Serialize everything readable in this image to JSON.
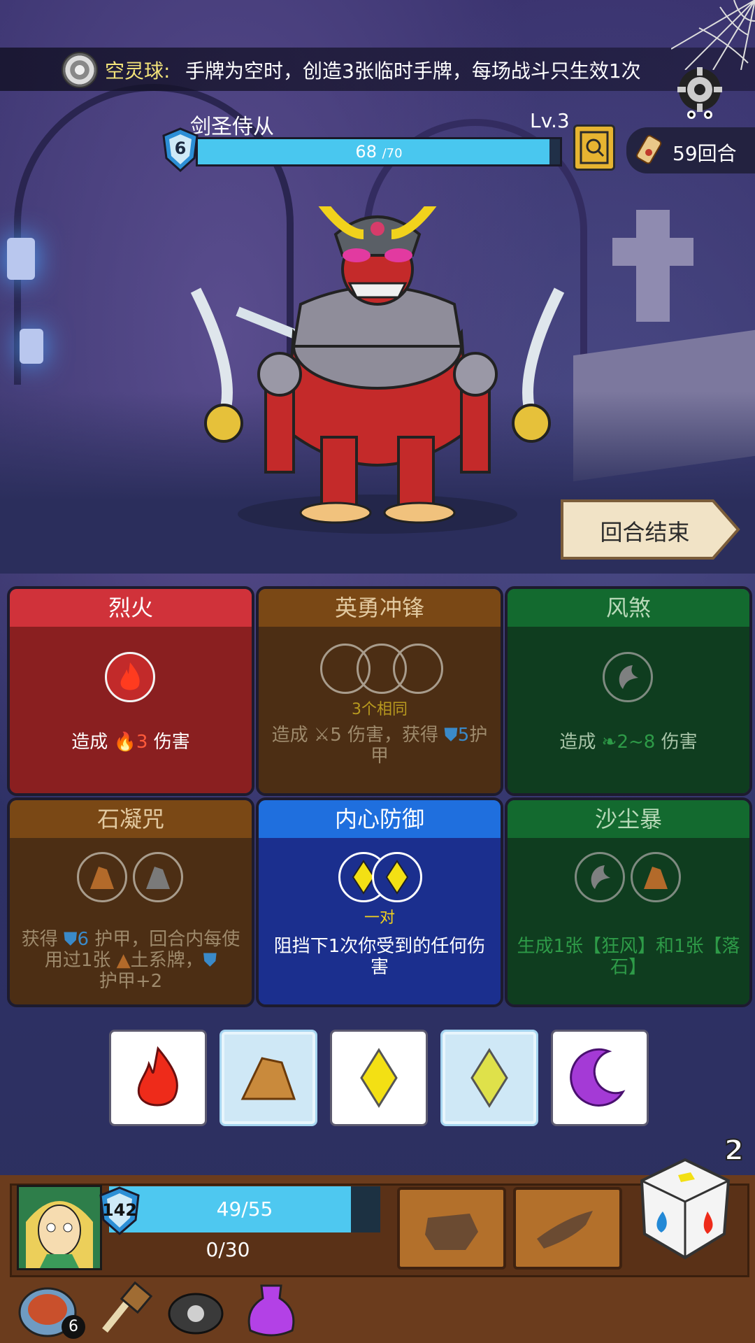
{
  "effect_banner": {
    "title": "空灵球:",
    "text": "手牌为空时，创造3张临时手牌，每场战斗只生效1次"
  },
  "enemy": {
    "name": "剑圣侍从",
    "level": "Lv.3",
    "shield": "6",
    "hp_current": "68",
    "hp_max": "/70",
    "hp_fraction": 0.971
  },
  "turns": {
    "label": "59回合"
  },
  "end_turn": {
    "label": "回合结束"
  },
  "cards": [
    {
      "title": "烈火",
      "desc_pre": "造成 ",
      "desc_val": "3",
      "desc_post": " 伤害",
      "color": "red"
    },
    {
      "title": "英勇冲锋",
      "sub": "3个相同",
      "desc_pre": "造成 ",
      "desc_val": "5",
      "desc_mid": " 伤害，获得 ",
      "desc_val2": "5",
      "desc_post": "护甲",
      "color": "brown"
    },
    {
      "title": "风煞",
      "desc_pre": "造成 ",
      "desc_val": "2~8",
      "desc_post": " 伤害",
      "color": "green"
    },
    {
      "title": "石凝咒",
      "desc_pre": "获得 ",
      "desc_val": "6",
      "desc_mid": " 护甲，回合内每使用过1张 ",
      "desc_mid2": "土系牌，",
      "desc_post": "护甲+2",
      "color": "brown"
    },
    {
      "title": "内心防御",
      "sub": "一对",
      "desc": "阻挡下1次你受到的任何伤害",
      "color": "blue"
    },
    {
      "title": "沙尘暴",
      "desc": "生成1张【狂风】和1张【落石】",
      "color": "green"
    }
  ],
  "hand_dice": [
    {
      "icon": "fire-icon",
      "frozen": false
    },
    {
      "icon": "rock-icon",
      "frozen": true
    },
    {
      "icon": "diamond-icon",
      "frozen": false
    },
    {
      "icon": "diamond-icon",
      "frozen": true
    },
    {
      "icon": "moon-icon",
      "frozen": false
    }
  ],
  "player": {
    "shield": "142",
    "hp": "49/55",
    "hp_fraction": 0.891,
    "mana": "0/30"
  },
  "dice_count": "2",
  "relics": [
    {
      "icon": "plate-icon",
      "count": "6"
    },
    {
      "icon": "hammer-icon"
    },
    {
      "icon": "cauldron-icon"
    },
    {
      "icon": "potion-icon"
    }
  ],
  "colors": {
    "hp": "#49c7ef",
    "red": "#d0323a",
    "blue": "#1f6fde",
    "green": "#136a2f",
    "brown": "#7a4815"
  }
}
